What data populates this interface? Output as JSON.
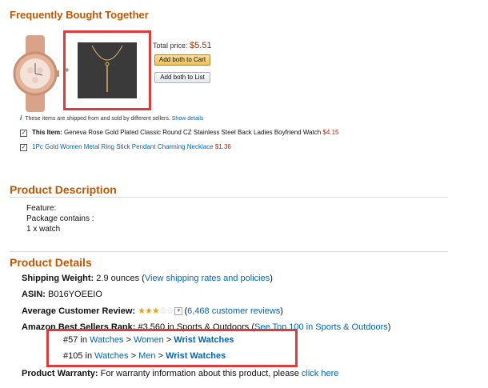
{
  "fbt": {
    "title": "Frequently Bought Together",
    "plus": "+",
    "total_label": "Total price:",
    "total_price": "$5.51",
    "add_cart_label": "Add both to Cart",
    "add_list_label": "Add both to List",
    "info_icon": "i",
    "shipping_note": "These items are shipped from and sold by different sellers.",
    "show_details": "Show details",
    "items": [
      {
        "prefix": "This Item:",
        "name": "Geneva Rose Gold Plated Classic Round CZ Stainless Steel Back Ladies Boyfriend Watch",
        "price": "$4.15",
        "checked": true
      },
      {
        "prefix": "",
        "name": "1Pc Gold Women Metal Ring Stick Pendant Charming Necklace",
        "price": "$1.36",
        "checked": true
      }
    ]
  },
  "description": {
    "title": "Product Description",
    "lines": [
      "Feature:",
      "Package contains :",
      "1 x watch"
    ]
  },
  "details": {
    "title": "Product Details",
    "shipping_weight_label": "Shipping Weight:",
    "shipping_weight_value": "2.9 ounces",
    "shipping_link": "View shipping rates and policies",
    "asin_label": "ASIN:",
    "asin_value": "B016YOEEIO",
    "review_label": "Average Customer Review:",
    "stars_filled": "★★★",
    "stars_empty": "☆☆",
    "review_link": "6,468 customer reviews",
    "rank_label": "Amazon Best Sellers Rank:",
    "rank_value": "#3,560 in Sports & Outdoors",
    "rank_link": "See Top 100 in Sports & Outdoors",
    "ranks": [
      {
        "rank": "#57 in",
        "c1": "Watches",
        "c2": "Women",
        "c3": "Wrist Watches"
      },
      {
        "rank": "#105 in",
        "c1": "Watches",
        "c2": "Men",
        "c3": "Wrist Watches"
      }
    ],
    "separator": ">",
    "warranty_label": "Product Warranty:",
    "warranty_text": "For warranty information about this product, please",
    "warranty_link": "click here"
  }
}
